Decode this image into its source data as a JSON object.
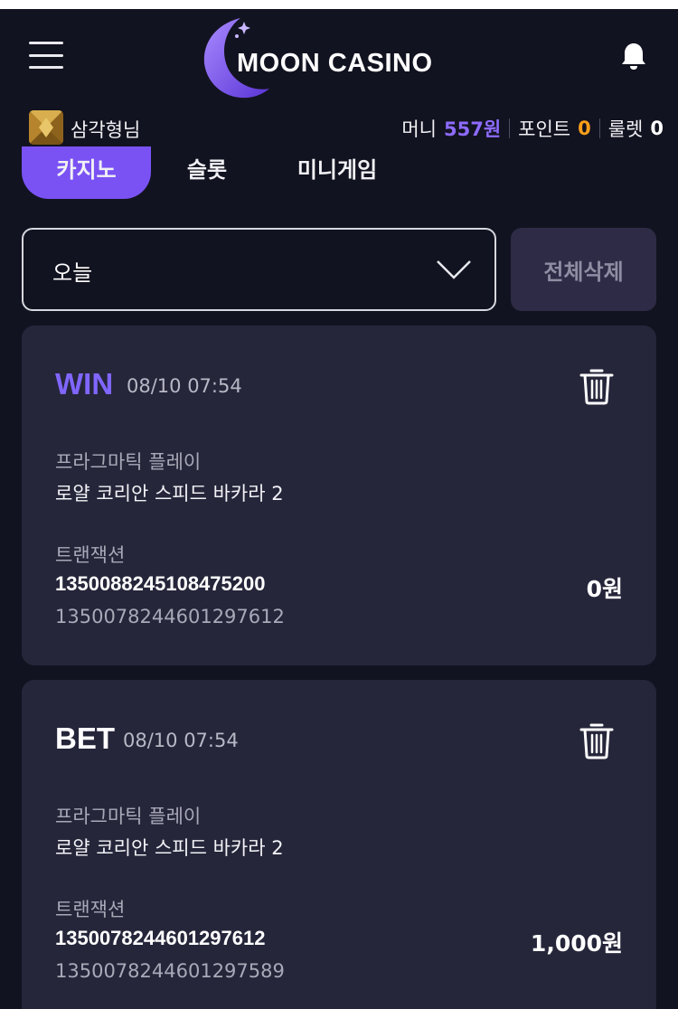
{
  "header": {
    "logo_text": "MOON CASINO",
    "bell_icon": "bell-icon",
    "menu_icon": "hamburger-menu-icon"
  },
  "user": {
    "name": "삼각형님",
    "money_label": "머니",
    "money_value": "557원",
    "point_label": "포인트",
    "point_value": "0",
    "roulette_label": "룰렛",
    "roulette_value": "0"
  },
  "tabs": [
    {
      "label": "카지노",
      "active": true
    },
    {
      "label": "슬롯",
      "active": false
    },
    {
      "label": "미니게임",
      "active": false
    }
  ],
  "filter": {
    "selected": "오늘",
    "delete_all_label": "전체삭제"
  },
  "records": [
    {
      "type": "WIN",
      "time": "08/10 07:54",
      "provider": "프라그마틱 플레이",
      "game": "로얄 코리안 스피드 바카라 2",
      "tx_label": "트랜잭션",
      "tx_id": "1350088245108475200",
      "tx_sub": "1350078244601297612",
      "amount": "0원"
    },
    {
      "type": "BET",
      "time": "08/10 07:54",
      "provider": "프라그마틱 플레이",
      "game": "로얄 코리안 스피드 바카라 2",
      "tx_label": "트랜잭션",
      "tx_id": "1350078244601297612",
      "tx_sub": "1350078244601297589",
      "amount": "1,000원"
    }
  ],
  "colors": {
    "background": "#121320",
    "card": "#25263a",
    "accent": "#7a52f4",
    "win": "#8066ff",
    "money": "#8d6bff",
    "point": "#ff9f1a"
  }
}
